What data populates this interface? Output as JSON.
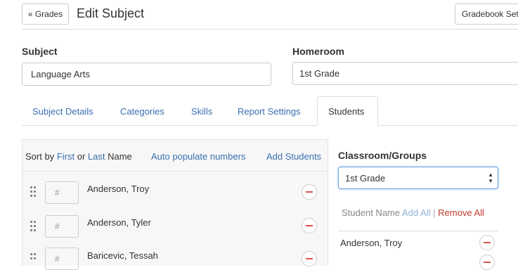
{
  "header": {
    "back_button": "« Grades",
    "title": "Edit Subject",
    "settings_button": "Gradebook Settings"
  },
  "form": {
    "subject_label": "Subject",
    "subject_value": "Language Arts",
    "homeroom_label": "Homeroom",
    "homeroom_value": "1st Grade"
  },
  "tabs": [
    {
      "label": "Subject Details",
      "active": false
    },
    {
      "label": "Categories",
      "active": false
    },
    {
      "label": "Skills",
      "active": false
    },
    {
      "label": "Report Settings",
      "active": false
    },
    {
      "label": "Students",
      "active": true
    }
  ],
  "students_panel": {
    "sort_by": "Sort by",
    "first": "First",
    "or": "or",
    "last": "Last",
    "name": "Name",
    "auto_populate": "Auto populate numbers",
    "add_students": "Add Students",
    "number_placeholder": "#",
    "rows": [
      {
        "name": "Anderson, Troy"
      },
      {
        "name": "Anderson, Tyler"
      },
      {
        "name": "Baricevic, Tessah"
      }
    ]
  },
  "groups_panel": {
    "title": "Classroom/Groups",
    "selected": "1st Grade",
    "student_name": "Student Name",
    "add_all": "Add All",
    "separator": "|",
    "remove_all": "Remove All",
    "rows": [
      {
        "name": "Anderson, Troy"
      }
    ]
  },
  "colors": {
    "link": "#3a6fb0",
    "danger": "#c0392b",
    "select_focus": "#6ba3e0"
  }
}
